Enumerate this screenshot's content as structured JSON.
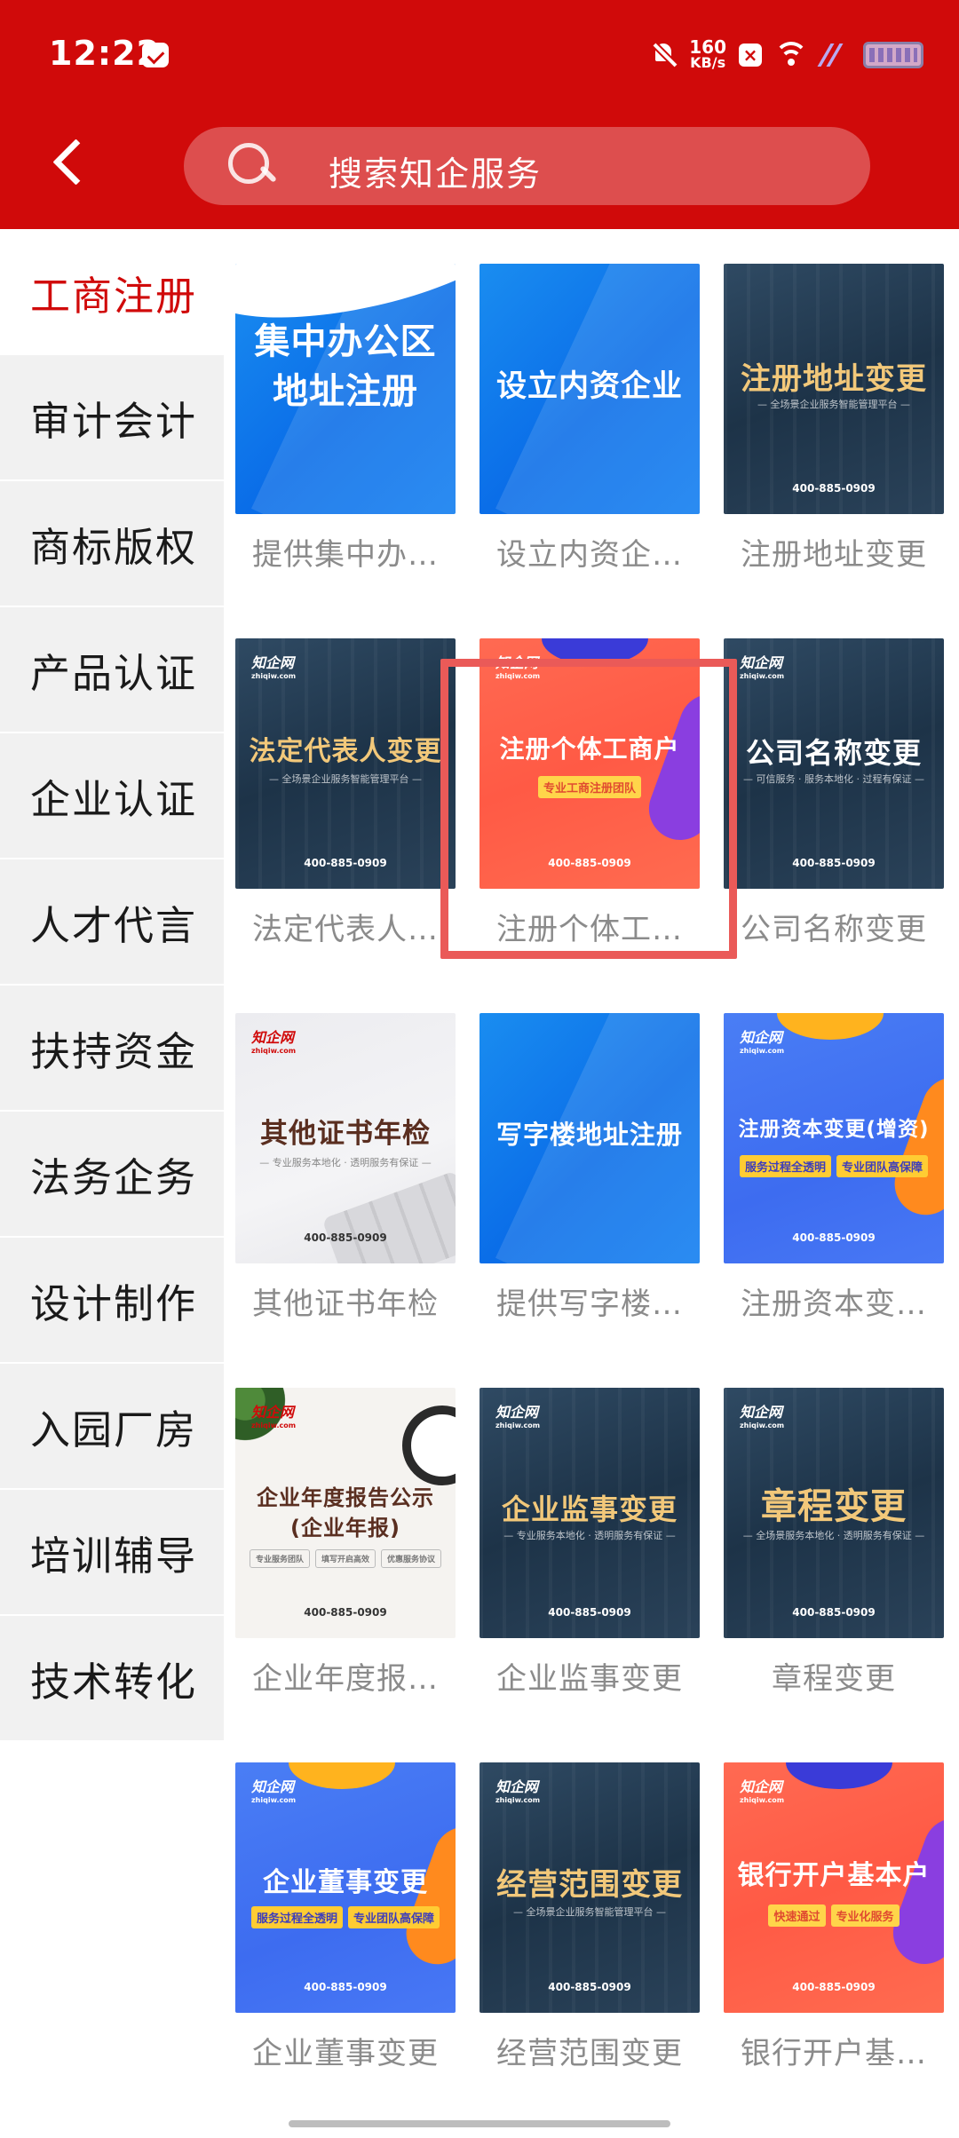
{
  "status_bar": {
    "time": "12:22",
    "net_speed_value": "160",
    "net_speed_unit": "KB/s"
  },
  "header": {
    "search_placeholder": "搜索知企服务"
  },
  "sidebar": {
    "items": [
      {
        "label": "工商注册",
        "active": true
      },
      {
        "label": "审计会计",
        "active": false
      },
      {
        "label": "商标版权",
        "active": false
      },
      {
        "label": "产品认证",
        "active": false
      },
      {
        "label": "企业认证",
        "active": false
      },
      {
        "label": "人才代言",
        "active": false
      },
      {
        "label": "扶持资金",
        "active": false
      },
      {
        "label": "法务企务",
        "active": false
      },
      {
        "label": "设计制作",
        "active": false
      },
      {
        "label": "入园厂房",
        "active": false
      },
      {
        "label": "培训辅导",
        "active": false
      },
      {
        "label": "技术转化",
        "active": false
      }
    ]
  },
  "services": [
    {
      "thumb_title": "集中办公区\n地址注册",
      "label": "提供集中办…"
    },
    {
      "thumb_title": "设立内资企业",
      "label": "设立内资企…"
    },
    {
      "thumb_title": "注册地址变更",
      "thumb_sub": "— 全场景企业服务智能管理平台 —",
      "thumb_phone": "400-885-0909",
      "label": "注册地址变更"
    },
    {
      "thumb_title": "法定代表人变更",
      "thumb_sub": "— 全场景企业服务智能管理平台 —",
      "thumb_phone": "400-885-0909",
      "label": "法定代表人…"
    },
    {
      "thumb_title": "注册个体工商户",
      "thumb_tag": "专业工商注册团队",
      "thumb_phone": "400-885-0909",
      "label": "注册个体工…"
    },
    {
      "thumb_title": "公司名称变更",
      "thumb_sub": "— 可信服务 · 服务本地化 · 过程有保证 —",
      "thumb_phone": "400-885-0909",
      "label": "公司名称变更"
    },
    {
      "thumb_title": "其他证书年检",
      "thumb_sub": "— 专业服务本地化 · 透明服务有保证 —",
      "thumb_phone": "400-885-0909",
      "label": "其他证书年检"
    },
    {
      "thumb_title": "写字楼地址注册",
      "label": "提供写字楼…"
    },
    {
      "thumb_title": "注册资本变更(增资)",
      "thumb_tags": [
        "服务过程全透明",
        "专业团队高保障"
      ],
      "thumb_phone": "400-885-0909",
      "label": "注册资本变…"
    },
    {
      "thumb_title": "企业年度报告公示\n(企业年报)",
      "thumb_tags": [
        "专业服务团队",
        "填写开启高效",
        "优惠服务协议"
      ],
      "thumb_phone": "400-885-0909",
      "label": "企业年度报…"
    },
    {
      "thumb_title": "企业监事变更",
      "thumb_sub": "— 专业服务本地化 · 透明服务有保证 —",
      "thumb_phone": "400-885-0909",
      "label": "企业监事变更"
    },
    {
      "thumb_title": "章程变更",
      "thumb_sub": "— 全场景服务本地化 · 透明服务有保证 —",
      "thumb_phone": "400-885-0909",
      "label": "章程变更"
    },
    {
      "thumb_title": "企业董事变更",
      "thumb_tags": [
        "服务过程全透明",
        "专业团队高保障"
      ],
      "thumb_phone": "400-885-0909",
      "label": "企业董事变更"
    },
    {
      "thumb_title": "经营范围变更",
      "thumb_sub": "— 全场景企业服务智能管理平台 —",
      "thumb_phone": "400-885-0909",
      "label": "经营范围变更"
    },
    {
      "thumb_title": "银行开户基本户",
      "thumb_tags": [
        "快速通过",
        "专业化服务"
      ],
      "thumb_phone": "400-885-0909",
      "label": "银行开户基…"
    }
  ],
  "brand": {
    "logo_text": "知企网",
    "logo_domain": "zhiqiw.com"
  },
  "colors": {
    "header_red": "#d00a0a",
    "active_text": "#d00a0a",
    "sidebar_bg": "#f1f1f1",
    "label_gray": "#8b8b8b",
    "highlight": "#ea5a58"
  }
}
